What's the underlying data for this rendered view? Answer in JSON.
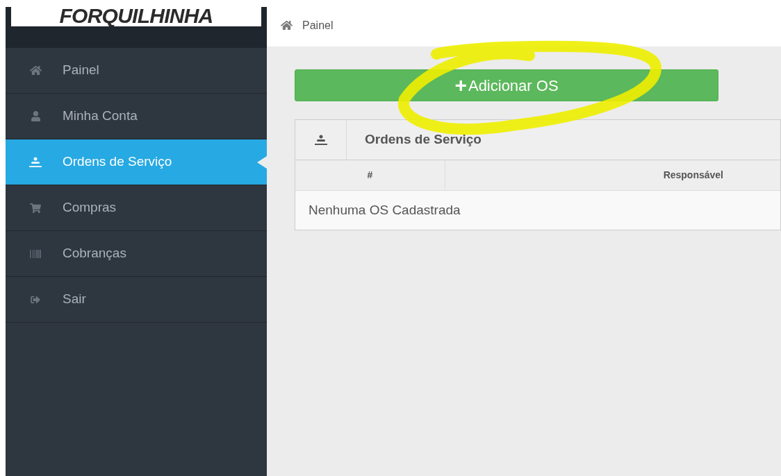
{
  "logo": {
    "text": "FORQUILHINHA"
  },
  "sidebar": {
    "items": [
      {
        "label": "Painel",
        "kind": "home",
        "selected": false
      },
      {
        "label": "Minha Conta",
        "kind": "account",
        "selected": false
      },
      {
        "label": "Ordens de Serviço",
        "kind": "orders",
        "selected": true
      },
      {
        "label": "Compras",
        "kind": "purchases",
        "selected": false
      },
      {
        "label": "Cobranças",
        "kind": "billing",
        "selected": false
      },
      {
        "label": "Sair",
        "kind": "logout",
        "selected": false
      }
    ]
  },
  "breadcrumb": {
    "label": "Painel"
  },
  "add_button": {
    "icon": "+",
    "label": "Adicionar OS"
  },
  "panel": {
    "title": "Ordens de Serviço"
  },
  "table": {
    "columns": [
      "#",
      "Responsável"
    ],
    "empty_message": "Nenhuma OS Cadastrada"
  }
}
